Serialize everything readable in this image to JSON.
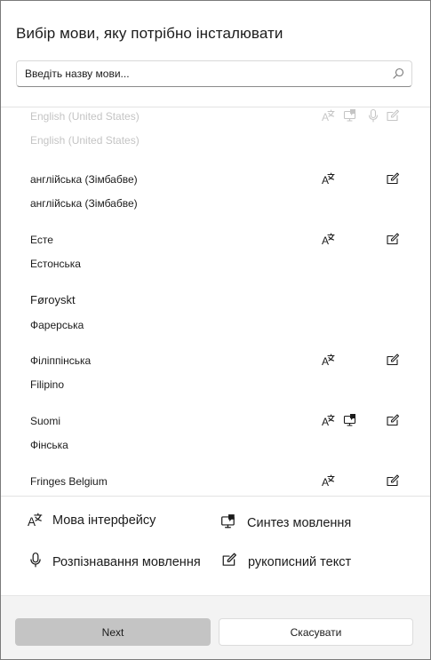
{
  "dialog": {
    "title": "Вибір мови, яку потрібно інсталювати"
  },
  "search": {
    "placeholder": "Введіть назву мови...",
    "value": "",
    "icon": "search-icon"
  },
  "languages": [
    {
      "native": "English (United States)",
      "localized": "English (United States)",
      "features": [
        "ui",
        "tts",
        "speech",
        "handwriting"
      ],
      "state": "disabled"
    },
    {
      "native": "англійська (Зімбабве)",
      "localized": "англійська (Зімбабве)",
      "features": [
        "ui",
        "handwriting"
      ]
    },
    {
      "native": "Есте",
      "localized": "Естонська",
      "features": [
        "ui",
        "handwriting"
      ]
    },
    {
      "native": "Føroyskt",
      "localized": "Фарерська",
      "features": []
    },
    {
      "native": "Філіппінська",
      "localized": "Filipino",
      "features": [
        "ui",
        "handwriting"
      ]
    },
    {
      "native": "Suomi",
      "localized": "Фінська",
      "features": [
        "ui",
        "tts",
        "handwriting"
      ]
    },
    {
      "native": "Fringes Belgium",
      "localized": "",
      "features": [
        "ui",
        "handwriting"
      ]
    }
  ],
  "legend": {
    "ui": "Мова інтерфейсу",
    "tts": "Синтез мовлення",
    "speech": "Розпізнавання мовлення",
    "handwriting": "рукописний текст"
  },
  "footer": {
    "next_label": "Next",
    "cancel_label": "Скасувати"
  },
  "colors": {
    "text": "#1b1b1b",
    "disabled_text": "#c4c4c4",
    "next_button_bg": "#c4c4c4",
    "footer_bg": "#f3f3f3",
    "border": "#7a7a7a"
  }
}
